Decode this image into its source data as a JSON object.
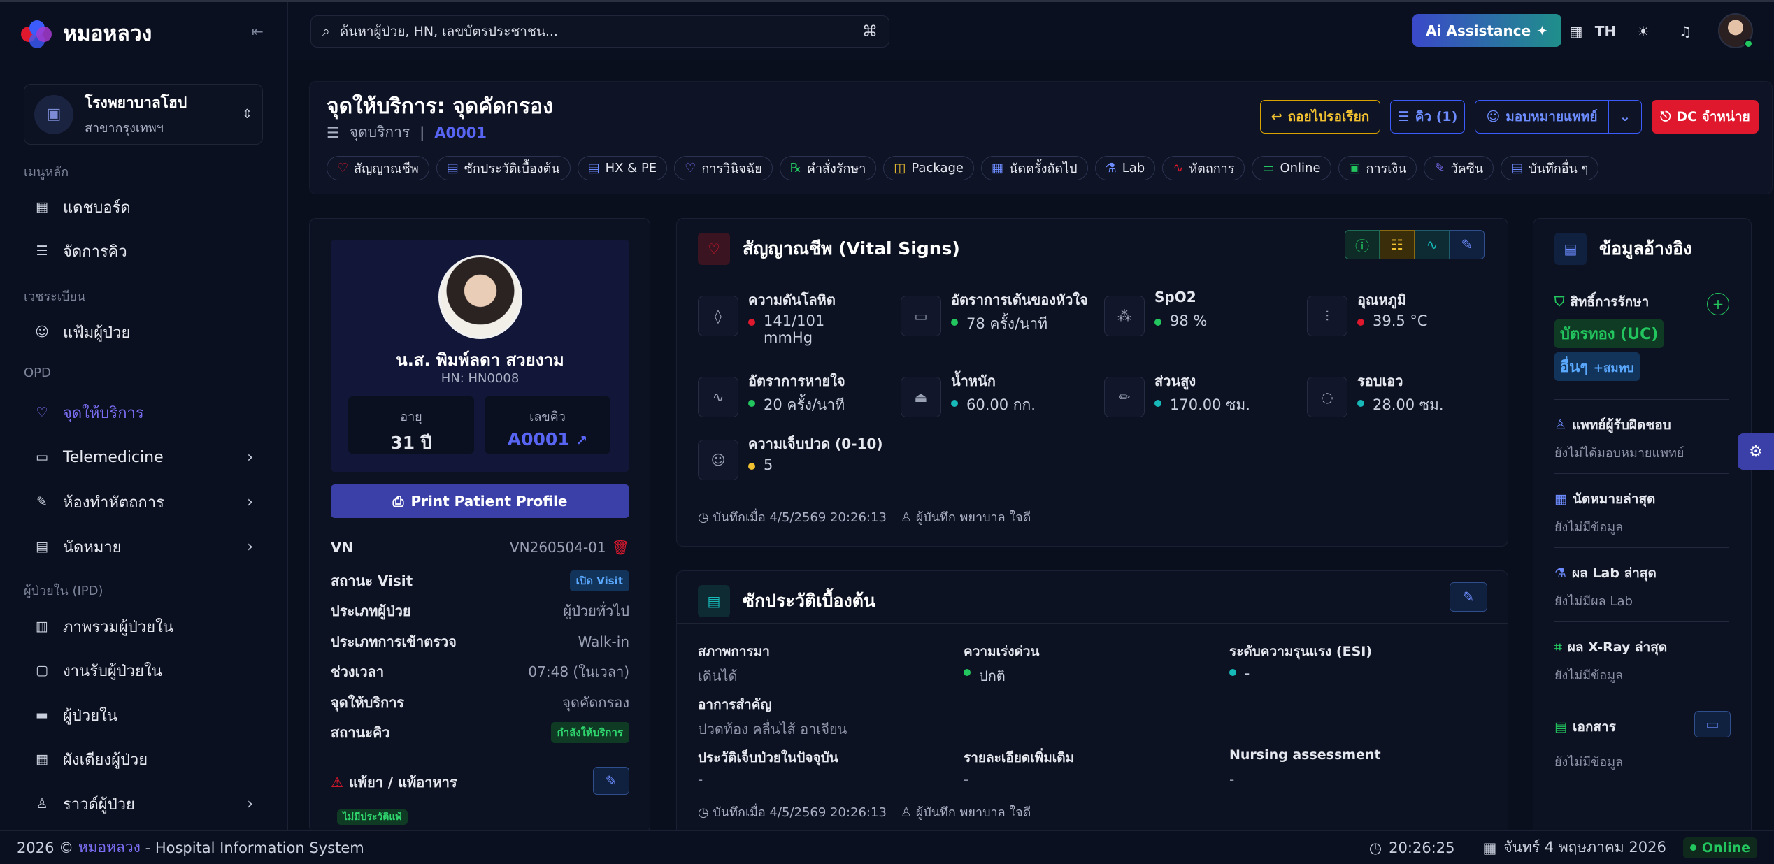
{
  "app": {
    "name": "หมอหลวง"
  },
  "hospital": {
    "name": "โรงพยาบาลโฮป",
    "branch": "สาขากรุงเทพฯ"
  },
  "sidebar": {
    "sections": [
      "เมนูหลัก",
      "เวชระเบียน",
      "OPD",
      "ผู้ป่วยใน (IPD)"
    ],
    "items": [
      {
        "label": "แดชบอร์ด",
        "icon": "grid-icon"
      },
      {
        "label": "จัดการคิว",
        "icon": "list-icon"
      },
      {
        "label": "แฟ้มผู้ป่วย",
        "icon": "user-folder-icon"
      },
      {
        "label": "จุดให้บริการ",
        "icon": "stethoscope-icon"
      },
      {
        "label": "Telemedicine",
        "icon": "video-icon"
      },
      {
        "label": "ห้องทำหัตถการ",
        "icon": "syringe-icon"
      },
      {
        "label": "นัดหมาย",
        "icon": "calendar-icon"
      },
      {
        "label": "ภาพรวมผู้ป่วยใน",
        "icon": "building-icon"
      },
      {
        "label": "งานรับผู้ป่วยใน",
        "icon": "file-plus-icon"
      },
      {
        "label": "ผู้ป่วยใน",
        "icon": "bed-icon"
      },
      {
        "label": "ผังเตียงผู้ป่วย",
        "icon": "grid-icon"
      },
      {
        "label": "ราวด์ผู้ป่วย",
        "icon": "walk-icon"
      }
    ]
  },
  "header": {
    "search_placeholder": "ค้นหาผู้ป่วย, HN, เลขบัตรประชาชน...",
    "ai_label": "Ai Assistance",
    "lang": "TH"
  },
  "service": {
    "title": "จุดให้บริการ: จุดคัดกรอง",
    "breadcrumb": "จุดบริการ",
    "queue": "A0001",
    "buttons": {
      "back": "ถอยไปรอเรียก",
      "queue": "คิว (1)",
      "assign": "มอบหมายแพทย์",
      "dc": "DC จำหน่าย"
    },
    "chips": [
      "สัญญาณชีพ",
      "ซักประวัติเบื้องต้น",
      "HX & PE",
      "การวินิจฉัย",
      "คำสั่งรักษา",
      "Package",
      "นัดครั้งถัดไป",
      "Lab",
      "หัตถการ",
      "Online",
      "การเงิน",
      "วัคซีน",
      "บันทึกอื่น ๆ"
    ]
  },
  "patient": {
    "name": "น.ส. พิมพ์ลดา สวยงาม",
    "hn": "HN: HN0008",
    "age_label": "อายุ",
    "age": "31 ปี",
    "queue_label": "เลขคิว",
    "queue": "A0001",
    "print_label": "Print Patient Profile",
    "rows": [
      {
        "k": "VN",
        "v": "VN260504-01"
      },
      {
        "k": "สถานะ Visit",
        "v": "เปิด Visit"
      },
      {
        "k": "ประเภทผู้ป่วย",
        "v": "ผู้ป่วยทั่วไป"
      },
      {
        "k": "ประเภทการเข้าตรวจ",
        "v": "Walk-in"
      },
      {
        "k": "ช่วงเวลา",
        "v": "07:48 (ในเวลา)"
      },
      {
        "k": "จุดให้บริการ",
        "v": "จุดคัดกรอง"
      },
      {
        "k": "สถานะคิว",
        "v": "กำลังให้บริการ"
      }
    ],
    "allergy_title": "แพ้ยา / แพ้อาหาร",
    "allergy_badge": "ไม่มีประวัติแพ้"
  },
  "vitals": {
    "title": "สัญญาณชีพ (Vital Signs)",
    "items": [
      {
        "label": "ความดันโลหิต",
        "value": "141/101",
        "unit": "mmHg",
        "status": "red"
      },
      {
        "label": "อัตราการเต้นของหัวใจ",
        "value": "78 ครั้ง/นาที",
        "status": "green"
      },
      {
        "label": "SpO2",
        "value": "98 %",
        "status": "green"
      },
      {
        "label": "อุณหภูมิ",
        "value": "39.5 °C",
        "status": "red"
      },
      {
        "label": "อัตราการหายใจ",
        "value": "20 ครั้ง/นาที",
        "status": "green"
      },
      {
        "label": "น้ำหนัก",
        "value": "60.00 กก.",
        "status": "cyan"
      },
      {
        "label": "ส่วนสูง",
        "value": "170.00 ซม.",
        "status": "cyan"
      },
      {
        "label": "รอบเอว",
        "value": "28.00 ซม.",
        "status": "cyan"
      },
      {
        "label": "ความเจ็บปวด (0-10)",
        "value": "5",
        "status": "yellow"
      }
    ],
    "saved_at": "บันทึกเมื่อ 4/5/2569 20:26:13",
    "saved_by": "ผู้บันทึก พยาบาล ใจดี"
  },
  "history": {
    "title": "ซักประวัติเบื้องต้น",
    "arrival_label": "สภาพการมา",
    "arrival": "เดินได้",
    "urgency_label": "ความเร่งด่วน",
    "urgency": "ปกติ",
    "esi_label": "ระดับความรุนแรง (ESI)",
    "esi": "-",
    "cc_label": "อาการสำคัญ",
    "cc": "ปวดท้อง คลื่นไส้ อาเจียน",
    "pi_label": "ประวัติเจ็บป่วยในปัจจุบัน",
    "pi": "-",
    "more_label": "รายละเอียดเพิ่มเติม",
    "more": "-",
    "na_label": "Nursing assessment",
    "na": "-",
    "saved_at": "บันทึกเมื่อ 4/5/2569 20:26:13",
    "saved_by": "ผู้บันทึก พยาบาล ใจดี"
  },
  "reference": {
    "title": "ข้อมูลอ้างอิง",
    "rights_label": "สิทธิ์การรักษา",
    "right1": "บัตรทอง (UC)",
    "right2": "อื่นๆ",
    "right2_extra": "+สมทบ",
    "doctor_label": "แพทย์ผู้รับผิดชอบ",
    "doctor": "ยังไม่ได้มอบหมายแพทย์",
    "appt_label": "นัดหมายล่าสุด",
    "appt": "ยังไม่มีข้อมูล",
    "lab_label": "ผล Lab ล่าสุด",
    "lab": "ยังไม่มีผล Lab",
    "xray_label": "ผล X-Ray ล่าสุด",
    "xray": "ยังไม่มีข้อมูล",
    "docs_label": "เอกสาร",
    "docs": "ยังไม่มีข้อมูล"
  },
  "footer": {
    "year": "2026 ©",
    "brand": "หมอหลวง",
    "rest": "- Hospital Information System",
    "time": "20:26:25",
    "date": "จันทร์ 4 พฤษภาคม 2026",
    "status": "Online"
  },
  "colors": {
    "accent": "#3a40a8",
    "danger": "#e0182d",
    "warning": "#d9a400",
    "success": "#22c55e",
    "cyan": "#16b8b8"
  }
}
